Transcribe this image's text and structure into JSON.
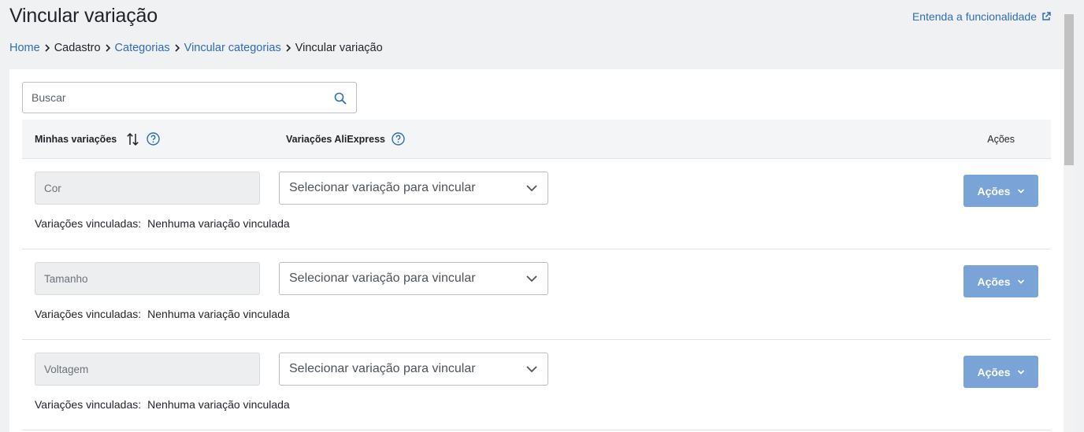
{
  "page": {
    "title": "Vincular variação",
    "help_link": "Entenda a funcionalidade"
  },
  "breadcrumb": [
    {
      "label": "Home",
      "link": true
    },
    {
      "label": "Cadastro",
      "link": false
    },
    {
      "label": "Categorias",
      "link": true
    },
    {
      "label": "Vincular categorias",
      "link": true
    },
    {
      "label": "Vincular variação",
      "link": false
    }
  ],
  "search": {
    "placeholder": "Buscar",
    "value": ""
  },
  "table": {
    "headers": {
      "mine": "Minhas variações",
      "ali": "Variações AliExpress",
      "actions": "Ações"
    },
    "rows": [
      {
        "variation": "Cor",
        "select_placeholder": "Selecionar variação para vincular",
        "action_label": "Ações",
        "linked_label": "Variações vinculadas:",
        "linked_value": "Nenhuma variação vinculada"
      },
      {
        "variation": "Tamanho",
        "select_placeholder": "Selecionar variação para vincular",
        "action_label": "Ações",
        "linked_label": "Variações vinculadas:",
        "linked_value": "Nenhuma variação vinculada"
      },
      {
        "variation": "Voltagem",
        "select_placeholder": "Selecionar variação para vincular",
        "action_label": "Ações",
        "linked_label": "Variações vinculadas:",
        "linked_value": "Nenhuma variação vinculada"
      }
    ]
  },
  "icons": {
    "external_link": "external-link-icon",
    "breadcrumb_separator": "chevron-right-icon",
    "search": "search-icon",
    "sort": "sort-arrows-icon",
    "help": "help-circle-icon",
    "select_chevron": "chevron-down-icon",
    "button_chevron": "chevron-down-icon"
  },
  "colors": {
    "link": "#2e6db4",
    "primary_button": "#7aa3d8",
    "page_background": "#eff1f3",
    "header_background": "#f4f5f7"
  }
}
